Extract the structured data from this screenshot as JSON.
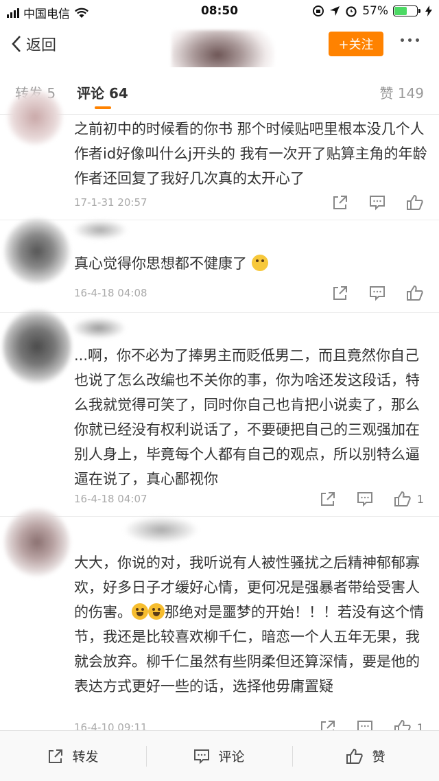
{
  "status_bar": {
    "carrier": "中国电信",
    "time": "08:50",
    "battery_percent": "57%",
    "battery_level": 0.57,
    "battery_color": "#4cd964"
  },
  "nav": {
    "back_label": "返回",
    "follow_label": "+关注",
    "accent_color": "#ff8200"
  },
  "tabs": {
    "repost": "转发 5",
    "comment": "评论 64",
    "like": "赞 149"
  },
  "comments": [
    {
      "text": "之前初中的时候看的你书 那个时候贴吧里根本没几个人 作者id好像叫什么j开头的 我有一次开了贴算主角的年龄作者还回复了我好几次真的太开心了",
      "time": "17-1-31 20:57",
      "likes": ""
    },
    {
      "text": "真心觉得你思想都不健康了",
      "emoji": "thinking-face",
      "time": "16-4-18 04:08",
      "likes": ""
    },
    {
      "text": "...啊，你不必为了捧男主而贬低男二，而且竟然你自己也说了怎么改编也不关你的事，你为啥还发这段话，特么我就觉得可笑了，同时你自己也肯把小说卖了，那么你就已经没有权利说话了，不要硬把自己的三观强加在别人身上，毕竟每个人都有自己的观点，所以别特么逼逼在说了，真心鄙视你",
      "time": "16-4-18 04:07",
      "likes": "1"
    },
    {
      "text_a": "大大，你说的对，我听说有人被性骚扰之后精神郁郁寡欢，好多日子才缓好心情，更何况是强暴者带给受害人的伤害。",
      "text_b": "那绝对是噩梦的开始！！！若没有这个情节，我还是比较喜欢柳千仁，暗恋一个人五年无果，我就会放弃。柳千仁虽然有些阴柔但还算深情，要是他的表达方式更好一些的话，选择他毋庸置疑",
      "emoji": "crying-face",
      "time": "16-4-10 09:11",
      "likes": "1"
    }
  ],
  "toolbar": {
    "repost": "转发",
    "comment": "评论",
    "like": "赞"
  }
}
